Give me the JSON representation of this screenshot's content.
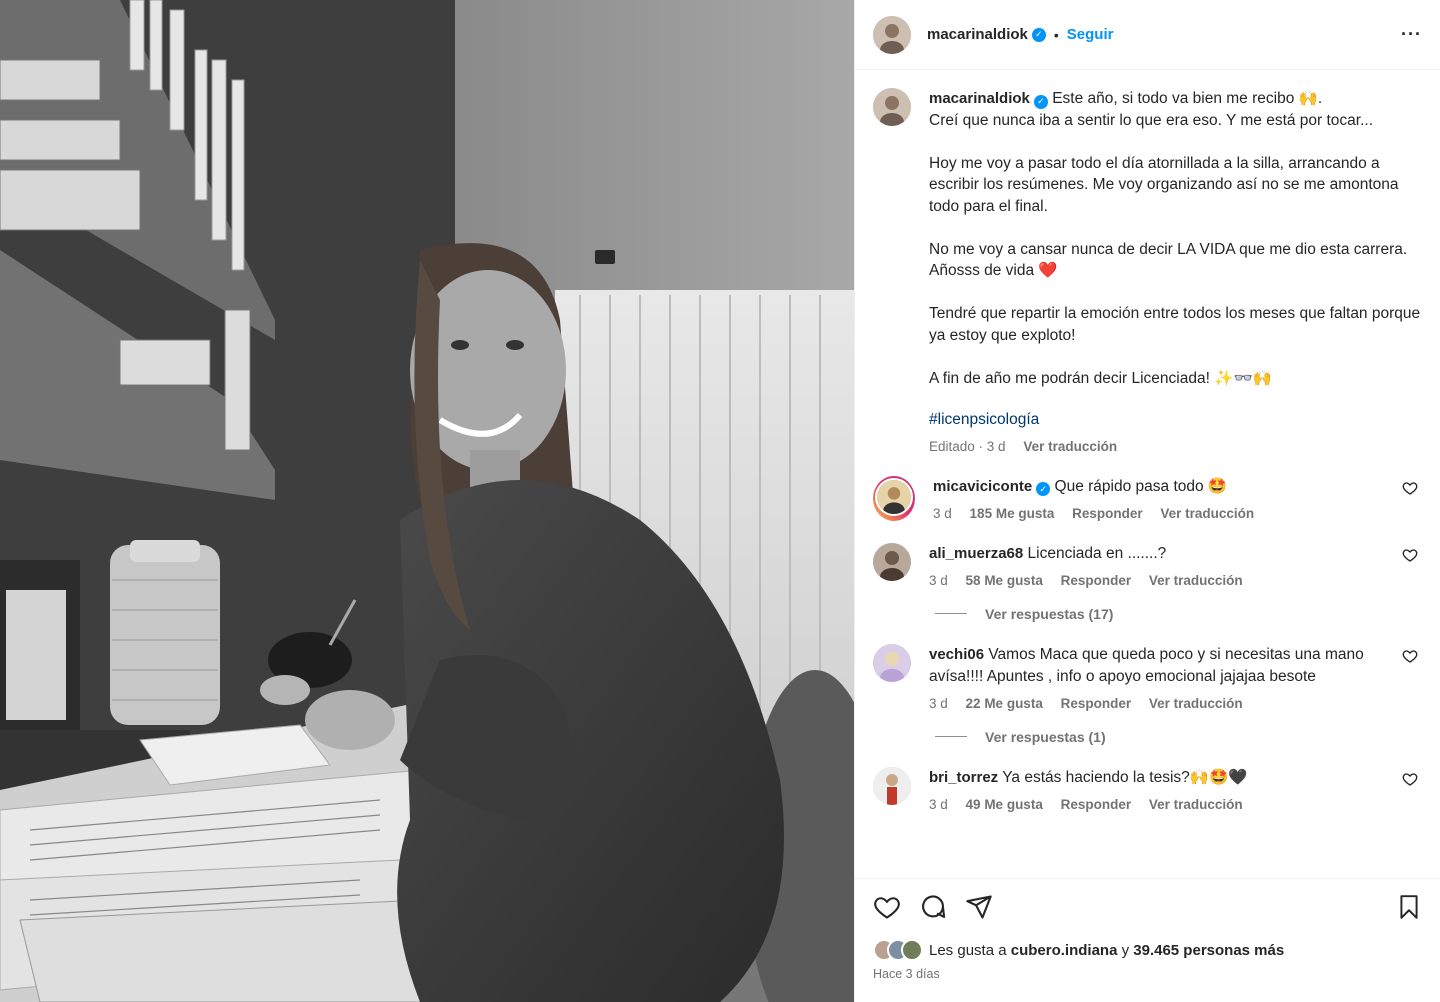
{
  "header": {
    "username": "macarinaldiok",
    "follow_label": "Seguir",
    "more_icon": "more-options-icon"
  },
  "caption": {
    "username": "macarinaldiok",
    "text": "Este año, si todo va bien me recibo 🙌.\nCreí que nunca iba a sentir lo que era eso. Y me está por tocar...\n\nHoy me voy a pasar todo el día atornillada a la silla, arrancando a escribir los resúmenes. Me voy organizando así no se me amontona todo para el final.\n\nNo me voy a cansar nunca de decir LA VIDA que me dio esta carrera. Añosss de vida ❤️\n\nTendré que repartir la emoción entre todos los meses que faltan porque ya estoy que exploto!\n\nA fin de año me podrán decir Licenciada! ✨👓🙌\n\n",
    "hashtag": "#licenpsicología",
    "edited": "Editado · 3 d",
    "translate": "Ver traducción"
  },
  "comments": [
    {
      "username": "micaviciconte",
      "verified": true,
      "text": "Que rápido pasa todo 🤩",
      "time": "3 d",
      "likes": "185 Me gusta",
      "reply": "Responder",
      "translate": "Ver traducción",
      "replies": ""
    },
    {
      "username": "ali_muerza68",
      "verified": false,
      "text": "Licenciada en .......?",
      "time": "3 d",
      "likes": "58 Me gusta",
      "reply": "Responder",
      "translate": "Ver traducción",
      "replies": "Ver respuestas (17)"
    },
    {
      "username": "vechi06",
      "verified": false,
      "text": "Vamos Maca que queda poco y si necesitas una mano avísa!!!! Apuntes , info o apoyo emocional jajajaa besote",
      "time": "3 d",
      "likes": "22 Me gusta",
      "reply": "Responder",
      "translate": "Ver traducción",
      "replies": "Ver respuestas (1)"
    },
    {
      "username": "bri_torrez",
      "verified": false,
      "text": "Ya estás haciendo la tesis?🙌🤩🖤",
      "time": "3 d",
      "likes": "49 Me gusta",
      "reply": "Responder",
      "translate": "Ver traducción",
      "replies": ""
    }
  ],
  "footer": {
    "likes_prefix": "Les gusta a",
    "likes_user": "cubero.indiana",
    "likes_suffix": "y",
    "likes_count": "39.465 personas más",
    "time_ago": "Hace 3 días"
  },
  "colors": {
    "accent": "#0095f6",
    "text": "#262626",
    "muted": "#737373",
    "hashtag": "#00376b"
  }
}
